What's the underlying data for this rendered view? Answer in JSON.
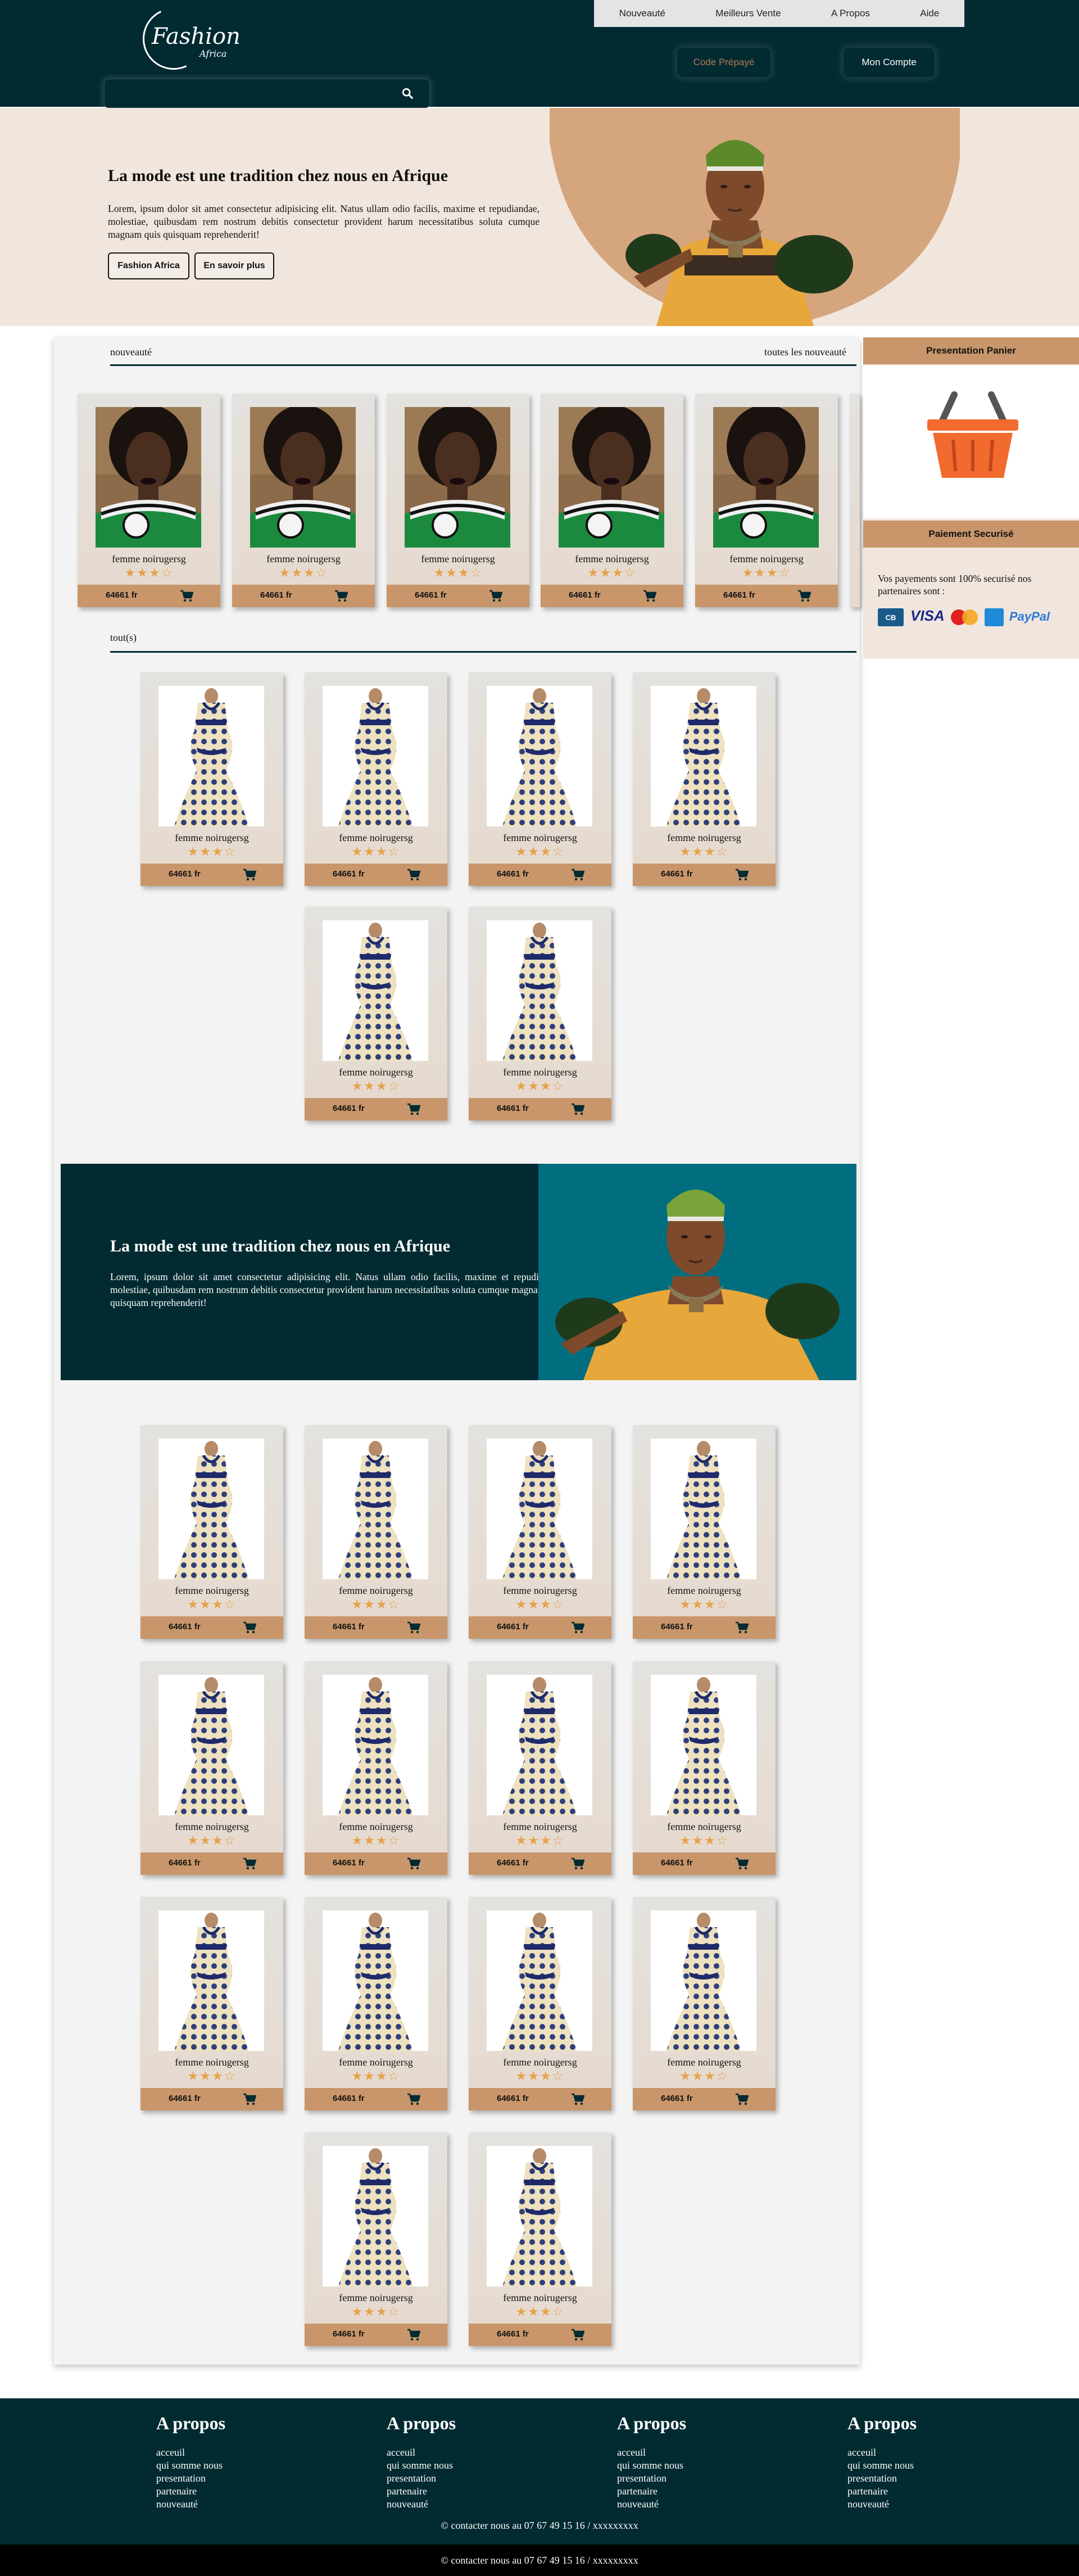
{
  "logo": {
    "line1": "Fashion",
    "line2": "Africa"
  },
  "nav": [
    "Nouveauté",
    "Meilleurs Vente",
    "A Propos",
    "Aide"
  ],
  "header_buttons": {
    "code": "Code Prépayé",
    "account": "Mon Compte"
  },
  "search": {
    "placeholder": "",
    "icon": "search-icon"
  },
  "hero": {
    "title": "La mode est une tradition chez nous en Afrique",
    "text": "Lorem, ipsum dolor sit amet consectetur adipisicing elit. Natus ullam odio facilis, maxime et repudiandae, molestiae, quibusdam rem nostrum debitis consectetur provident harum necessitatibus soluta cumque magnam quis quisquam reprehenderit!",
    "button1": "Fashion Africa",
    "button2": "En savoir plus"
  },
  "nouveaute": {
    "title": "nouveauté",
    "link": "toutes les nouveauté"
  },
  "tous": {
    "title": "tout(s)"
  },
  "product": {
    "name": "femme noirugersg",
    "price": "64661 fr",
    "stars": "★★★☆",
    "cart_icon": "cart-icon"
  },
  "banner": {
    "title": "La mode est une tradition chez nous en Afrique",
    "text": "Lorem, ipsum dolor sit amet consectetur adipisicing elit. Natus ullam odio facilis, maxime et repudiandae, molestiae, quibusdam rem nostrum debitis consectetur provident harum necessitatibus soluta cumque magnam quis quisquam reprehenderit!"
  },
  "side": {
    "basket_title": "Presentation Panier",
    "payment_title": "Paiement Securisé",
    "payment_text": "Vos payements sont 100% securisé nos partenaires sont :",
    "payment_logos": [
      "CB",
      "VISA",
      "MasterCard",
      "AMEX",
      "PayPal"
    ]
  },
  "footer": {
    "columns": [
      {
        "title": "A propos",
        "links": [
          "acceuil",
          "qui somme nous",
          "presentation",
          "partenaire",
          "nouveauté"
        ]
      },
      {
        "title": "A propos",
        "links": [
          "acceuil",
          "qui somme nous",
          "presentation",
          "partenaire",
          "nouveauté"
        ]
      },
      {
        "title": "A propos",
        "links": [
          "acceuil",
          "qui somme nous",
          "presentation",
          "partenaire",
          "nouveauté"
        ]
      },
      {
        "title": "A propos",
        "links": [
          "acceuil",
          "qui somme nous",
          "presentation",
          "partenaire",
          "nouveauté"
        ]
      }
    ],
    "copyright": "© contacter nous au 07 67 49 15 16 / xxxxxxxxx",
    "bottom": "© contacter nous au 07 67 49 15 16 / xxxxxxxxx"
  },
  "colors": {
    "dark": "#022a31",
    "accent": "#c8966a",
    "cream": "#f1e6dd",
    "teal": "#006e7f"
  }
}
